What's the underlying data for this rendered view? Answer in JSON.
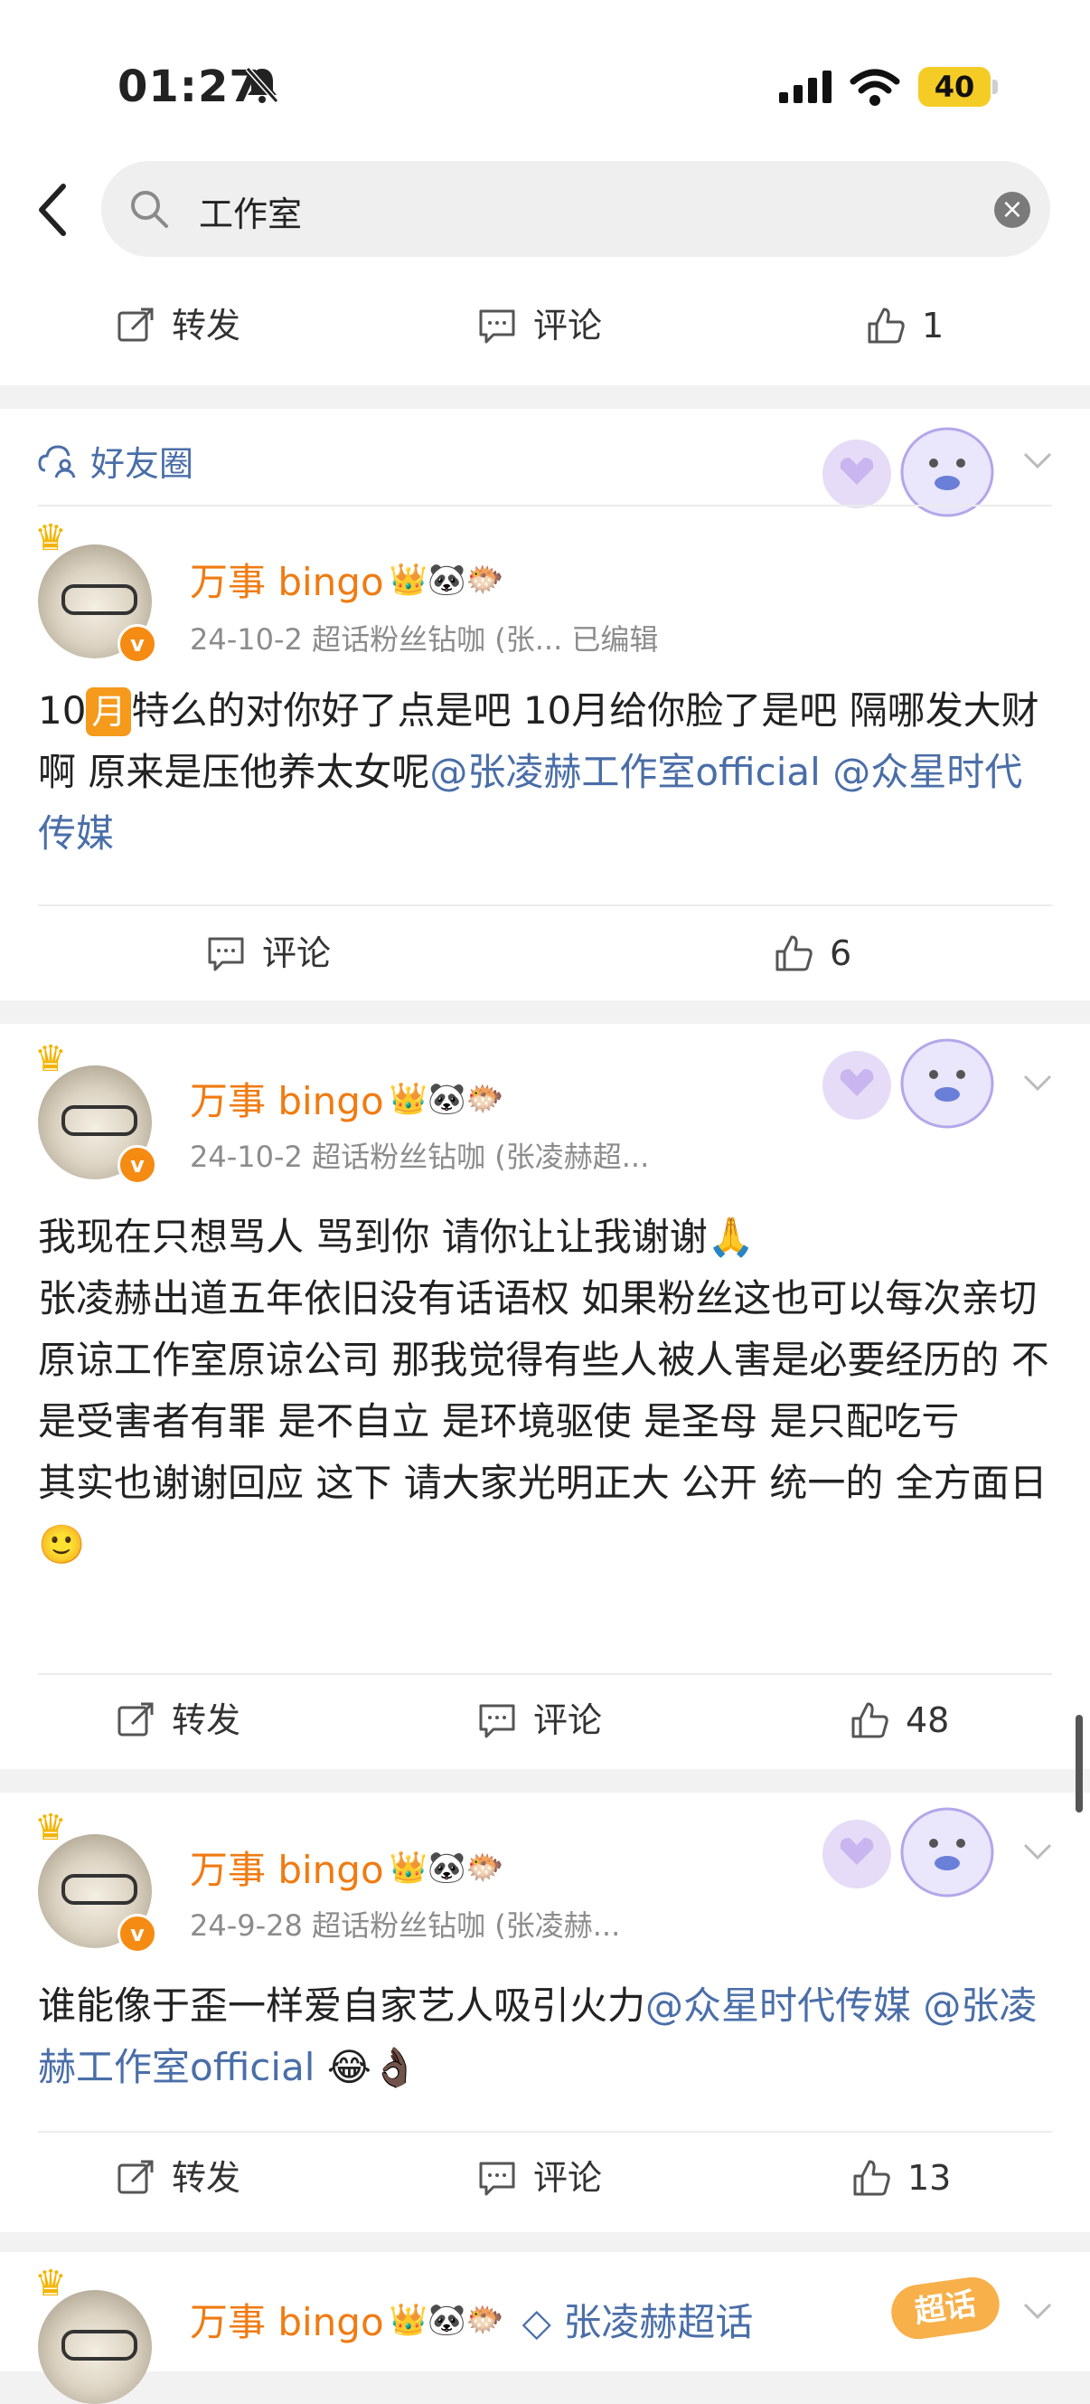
{
  "status_bar": {
    "time": "01:27",
    "battery": "40"
  },
  "search": {
    "query": "工作室"
  },
  "post0_actions": {
    "repost": "转发",
    "comment": "评论",
    "like_count": "1"
  },
  "group": {
    "label": "好友圈"
  },
  "posts": [
    {
      "author": "万事 bingo",
      "badges": "👑🐼🐡",
      "meta": "24-10-2   超话粉丝钻咖 (张...   已编辑",
      "text_a": "10",
      "text_box": "月",
      "text_b": "特么的对你好了点是吧 10月给你脸了是吧 隔哪发大财啊 原来是压他养太女呢",
      "mention1": "@张凌赫工作室official",
      "mention2": "@众星时代传媒",
      "comment": "评论",
      "like_count": "6"
    },
    {
      "author": "万事 bingo",
      "badges": "👑🐼🐡",
      "meta": "24-10-2   超话粉丝钻咖 (张凌赫超...",
      "line1": "我现在只想骂人 骂到你 请你让让我谢谢🙏",
      "line2": "张凌赫出道五年依旧没有话语权 如果粉丝这也可以每次亲切原谅工作室原谅公司 那我觉得有些人被人害是必要经历的 不是受害者有罪 是不自立 是环境驱使 是圣母 是只配吃亏",
      "line3": "其实也谢谢回应 这下 请大家光明正大 公开 统一的 全方面日🙂",
      "repost": "转发",
      "comment": "评论",
      "like_count": "48"
    },
    {
      "author": "万事 bingo",
      "badges": "👑🐼🐡",
      "meta": "24-9-28   超话粉丝钻咖 (张凌赫...",
      "text": "谁能像于歪一样爱自家艺人吸引火力",
      "mention1": "@众星时代传媒",
      "mention2": "@张凌赫工作室official",
      "emoji": "😂👌🏿",
      "repost": "转发",
      "comment": "评论",
      "like_count": "13"
    },
    {
      "author": "万事 bingo",
      "badges": "👑🐼🐡",
      "topic": "张凌赫超话",
      "sticker": "超话"
    }
  ],
  "colors": {
    "accent_orange": "#f07b12",
    "link_blue": "#4a6ea8",
    "battery_yellow": "#f5cc26"
  }
}
